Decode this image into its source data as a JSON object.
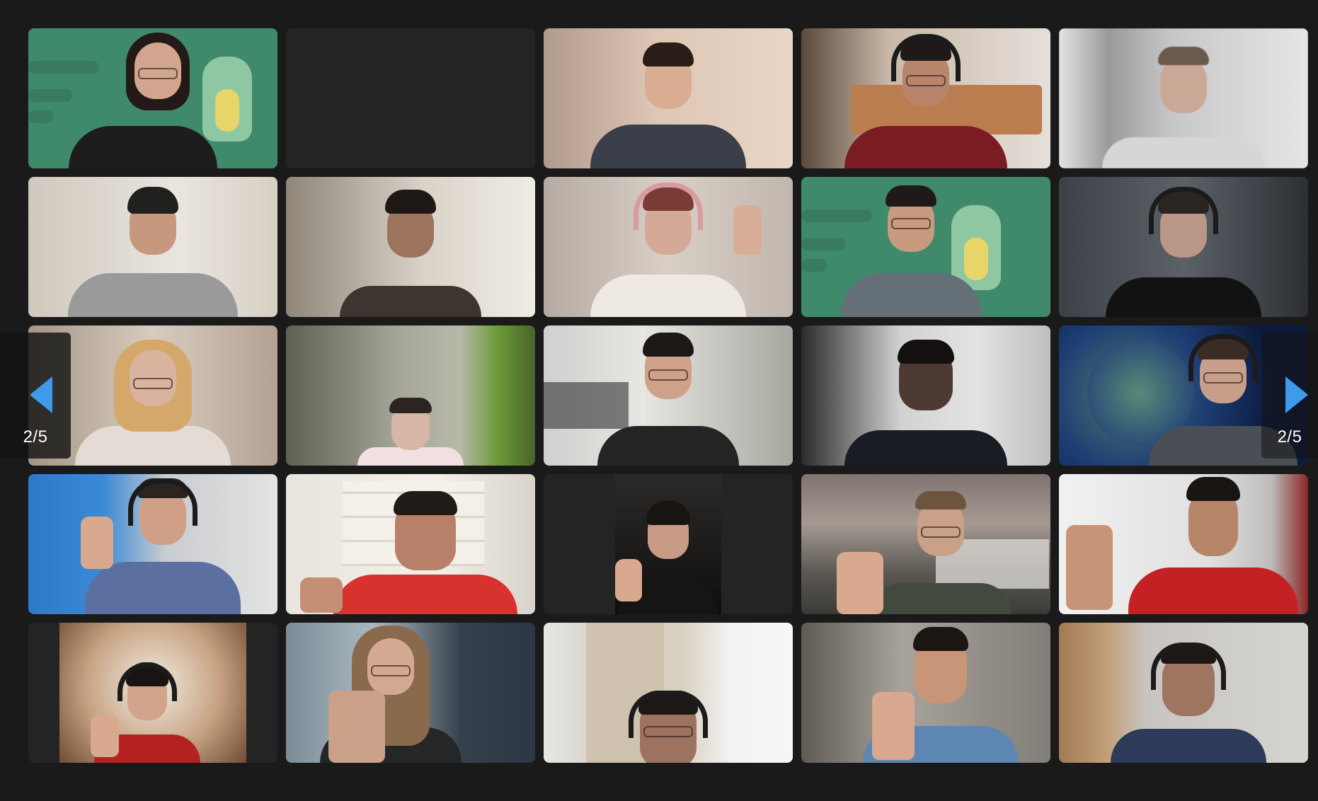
{
  "meeting": {
    "view": "gallery"
  },
  "pagination": {
    "current_page_label": "2/5",
    "arrow_color": "#3d9be9"
  },
  "participants": [
    {
      "tile": 1,
      "video": "on",
      "background": "green-virtual-background-crocodile"
    },
    {
      "tile": 2,
      "video": "off"
    },
    {
      "tile": 3,
      "video": "on",
      "headset": true
    },
    {
      "tile": 4,
      "video": "on",
      "headset": true
    },
    {
      "tile": 5,
      "video": "on",
      "background": "blurred"
    },
    {
      "tile": 6,
      "video": "on"
    },
    {
      "tile": 7,
      "video": "on"
    },
    {
      "tile": 8,
      "video": "on",
      "headset": true,
      "gesture": "hand-sign"
    },
    {
      "tile": 9,
      "video": "on",
      "background": "green-virtual-background-crocodile"
    },
    {
      "tile": 10,
      "video": "on",
      "headset": true
    },
    {
      "tile": 11,
      "video": "on"
    },
    {
      "tile": 12,
      "video": "on"
    },
    {
      "tile": 13,
      "video": "on"
    },
    {
      "tile": 14,
      "video": "on"
    },
    {
      "tile": 15,
      "video": "on",
      "headset": true,
      "background": "binary-code-tunnel"
    },
    {
      "tile": 16,
      "video": "on",
      "headset": true,
      "gesture": "thumbs-up"
    },
    {
      "tile": 17,
      "video": "on",
      "gesture": "thumbs-up"
    },
    {
      "tile": 18,
      "video": "on",
      "gesture": "thumbs-up"
    },
    {
      "tile": 19,
      "video": "on",
      "gesture": "thumbs-up"
    },
    {
      "tile": 20,
      "video": "on",
      "gesture": "thumbs-up"
    },
    {
      "tile": 21,
      "video": "on",
      "headset": true,
      "gesture": "thumbs-up"
    },
    {
      "tile": 22,
      "video": "on",
      "gesture": "thumbs-up"
    },
    {
      "tile": 23,
      "video": "on",
      "headset": true
    },
    {
      "tile": 24,
      "video": "on",
      "gesture": "thumbs-up"
    },
    {
      "tile": 25,
      "video": "on",
      "headset": true
    }
  ],
  "colors": {
    "app_background": "#1a1a1a",
    "empty_tile": "#242424",
    "virtual_background_green": "#3f8a6a"
  }
}
